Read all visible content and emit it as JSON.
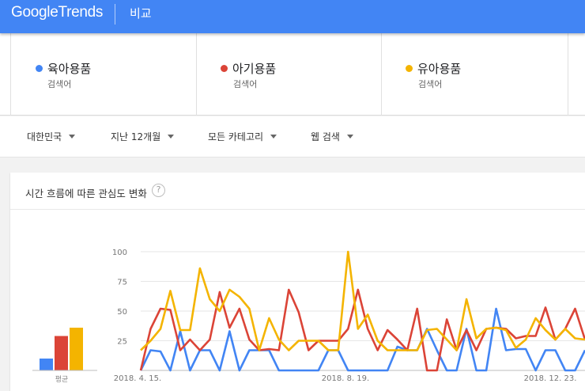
{
  "header": {
    "logo_google": "Google",
    "logo_trends": "Trends",
    "title": "비교"
  },
  "terms": [
    {
      "name": "육아용품",
      "type": "검색어",
      "color": "#4285f4"
    },
    {
      "name": "아기용품",
      "type": "검색어",
      "color": "#db4437"
    },
    {
      "name": "유아용품",
      "type": "검색어",
      "color": "#f4b400"
    }
  ],
  "filters": {
    "region": "대한민국",
    "period": "지난 12개월",
    "category": "모든 카테고리",
    "search_type": "웹 검색"
  },
  "chart_card": {
    "title": "시간 흐름에 따른 관심도 변화",
    "help_icon": "?"
  },
  "chart_data": {
    "type": "line",
    "average_label": "평균",
    "averages": [
      10,
      29,
      36
    ],
    "ylim": [
      0,
      100
    ],
    "yticks": [
      25,
      50,
      75,
      100
    ],
    "xtick_labels": [
      "2018. 4. 15.",
      "2018. 8. 19.",
      "2018. 12. 23."
    ],
    "series": [
      {
        "name": "육아용품",
        "color": "#4285f4",
        "values": [
          0,
          17,
          16,
          0,
          33,
          0,
          17,
          17,
          0,
          33,
          0,
          17,
          17,
          17,
          0,
          0,
          0,
          0,
          0,
          17,
          17,
          0,
          0,
          0,
          0,
          0,
          20,
          17,
          17,
          35,
          17,
          0,
          0,
          35,
          0,
          0,
          52,
          17,
          18,
          18,
          0,
          17,
          17,
          0,
          0,
          17
        ]
      },
      {
        "name": "아기용품",
        "color": "#db4437",
        "values": [
          0,
          35,
          52,
          51,
          17,
          26,
          17,
          26,
          66,
          36,
          52,
          26,
          17,
          18,
          17,
          68,
          49,
          17,
          25,
          25,
          25,
          35,
          68,
          35,
          17,
          34,
          26,
          17,
          52,
          0,
          0,
          43,
          17,
          34,
          17,
          35,
          36,
          35,
          27,
          29,
          29,
          53,
          26,
          35,
          52,
          26
        ]
      },
      {
        "name": "유아용품",
        "color": "#f4b400",
        "values": [
          17,
          25,
          35,
          67,
          34,
          34,
          86,
          60,
          50,
          68,
          62,
          52,
          17,
          44,
          26,
          17,
          25,
          25,
          25,
          17,
          17,
          100,
          35,
          47,
          25,
          17,
          17,
          17,
          17,
          34,
          35,
          26,
          17,
          60,
          27,
          35,
          36,
          34,
          19,
          26,
          44,
          34,
          26,
          35,
          27,
          26
        ]
      }
    ]
  }
}
